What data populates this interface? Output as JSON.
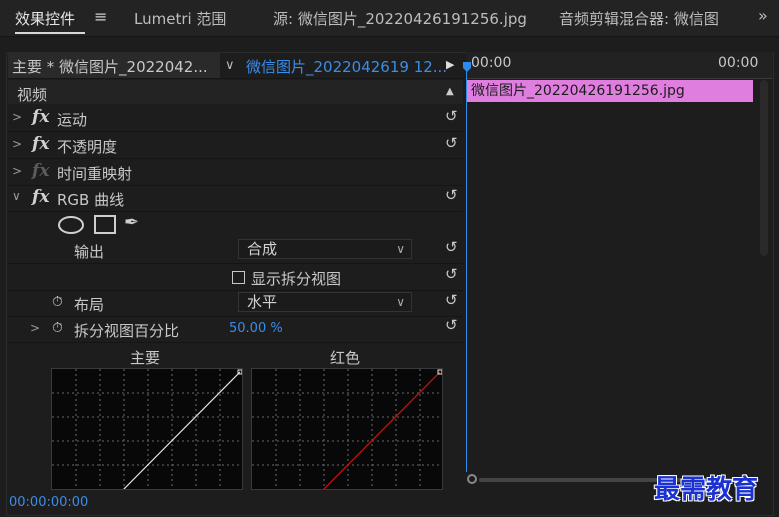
{
  "tabs": {
    "effects_controls": "效果控件",
    "menu_icon": "≡",
    "lumetri": "Lumetri 范围",
    "source": "源: 微信图片_20220426191256.jpg",
    "audio_mixer": "音频剪辑混合器: 微信图",
    "more": "»"
  },
  "header": {
    "master_label": "主要 * 微信图片_2022042...",
    "clip_label": "微信图片_2022042619 12...",
    "play_icon": "▶",
    "chevron": "∨"
  },
  "timeline": {
    "tc_start": "00:00",
    "tc_end": "00:00",
    "clip_name": "微信图片_20220426191256.jpg"
  },
  "section_video": "视频",
  "effects": [
    {
      "label": "运动"
    },
    {
      "label": "不透明度"
    },
    {
      "label": "时间重映射"
    },
    {
      "label": "RGB 曲线"
    }
  ],
  "properties": {
    "output_label": "输出",
    "output_value": "合成",
    "split_view_label": "显示拆分视图",
    "layout_label": "布局",
    "layout_value": "水平",
    "split_percent_label": "拆分视图百分比",
    "split_percent_value": "50.00 %"
  },
  "graphs": {
    "master_title": "主要",
    "red_title": "红色"
  },
  "footer": {
    "timecode": "00:00:00:00",
    "watermark": "最需教育"
  },
  "colors": {
    "accent_blue": "#3b8de8",
    "clip_pink": "#e07ee0",
    "red_curve": "#d01010"
  }
}
